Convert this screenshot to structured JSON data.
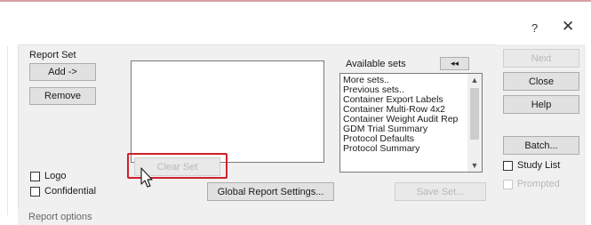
{
  "window": {
    "help_label": "?",
    "close_label": "✕"
  },
  "report_set": {
    "group_label": "Report Set",
    "add_label": "Add ->",
    "remove_label": "Remove",
    "clear_set_label": "Clear Set"
  },
  "available_sets": {
    "label": "Available sets",
    "collapse_label": "◂◂",
    "items": [
      "More sets..",
      "Previous sets..",
      "Container Export Labels",
      "Container Multi-Row 4x2",
      "Container Weight Audit Rep",
      "GDM Trial Summary",
      "Protocol Defaults",
      "Protocol Summary"
    ]
  },
  "options": {
    "logo_label": "Logo",
    "confidential_label": "Confidential",
    "global_settings_label": "Global Report Settings...",
    "save_set_label": "Save Set...",
    "report_options_label": "Report options"
  },
  "right_column": {
    "next_label": "Next",
    "close_label": "Close",
    "help_label": "Help",
    "batch_label": "Batch...",
    "study_list_label": "Study List",
    "prompted_label": "Prompted"
  },
  "colors": {
    "highlight": "#d0202a",
    "panel": "#f0f0f0"
  }
}
